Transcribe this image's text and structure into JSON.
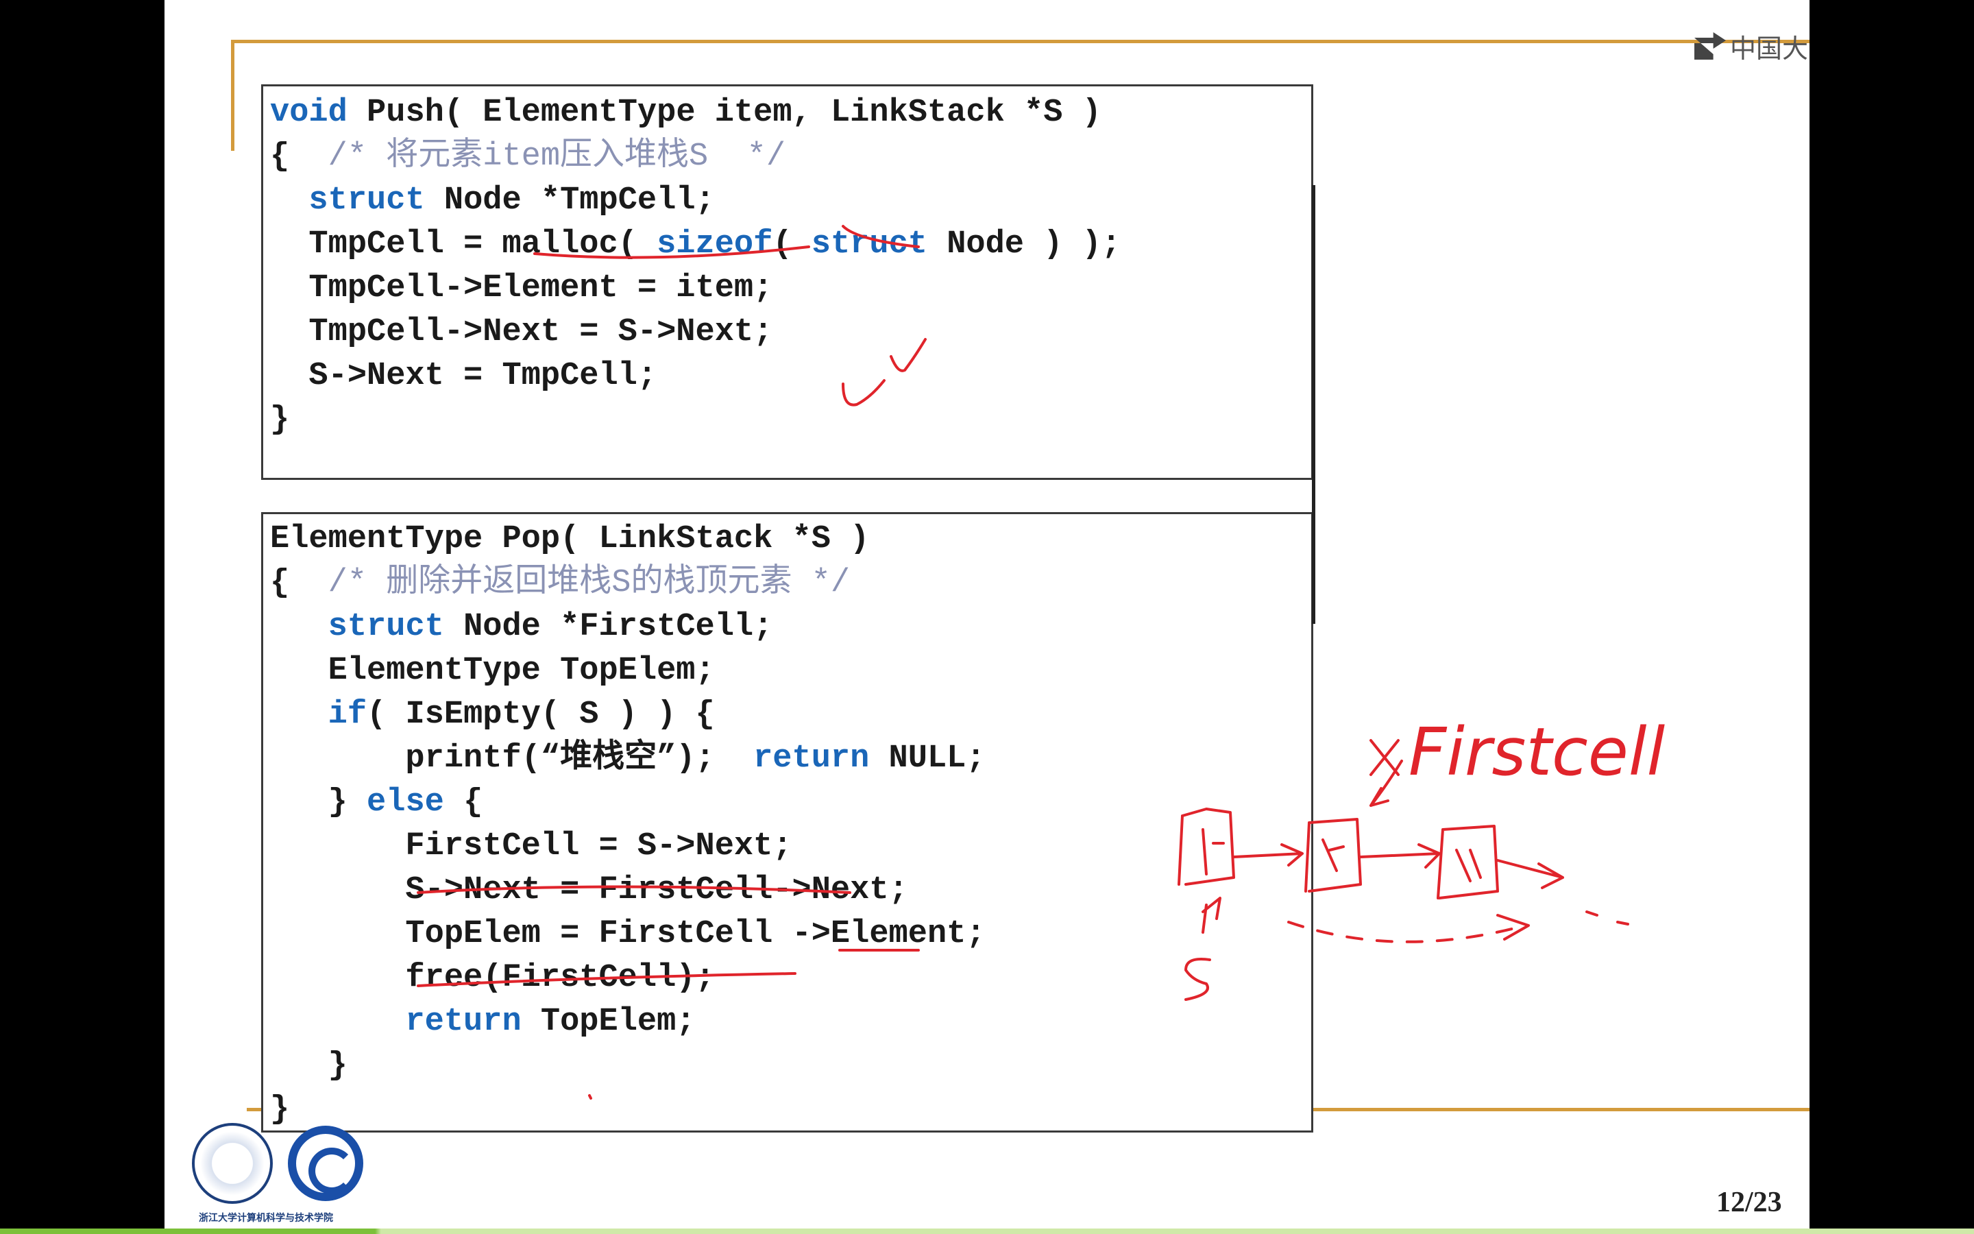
{
  "header": {
    "brand_text": "中国大"
  },
  "push_code": {
    "lines": [
      "void Push( ElementType item, LinkStack *S )",
      "{  /* 将元素item压入堆栈S  */",
      "  struct Node *TmpCell;",
      "  TmpCell = malloc( sizeof( struct Node ) );",
      "  TmpCell->Element = item;",
      "  TmpCell->Next = S->Next;",
      "  S->Next = TmpCell;",
      "}"
    ]
  },
  "pop_code": {
    "lines": [
      "ElementType Pop( LinkStack *S )",
      "{  /* 删除并返回堆栈S的栈顶元素 */",
      "   struct Node *FirstCell;",
      "   ElementType TopElem;",
      "   if( IsEmpty( S ) ) {",
      "       printf(“堆栈空”);  return NULL;",
      "   } else {",
      "       FirstCell = S->Next;",
      "       S->Next = FirstCell->Next;",
      "       TopElem = FirstCell ->Element;",
      "       free(FirstCell);",
      "       return TopElem;",
      "   }",
      "}"
    ]
  },
  "annotations": {
    "handwritten_label": "Firstcell",
    "handwritten_x": "X",
    "handwritten_s": "S"
  },
  "footer": {
    "caption": "浙江大学计算机科学与技术学院",
    "page_number": "12/23"
  },
  "colors": {
    "accent_rule": "#d39b3c",
    "keyword": "#1a66b8",
    "ink": "#e0242b"
  }
}
